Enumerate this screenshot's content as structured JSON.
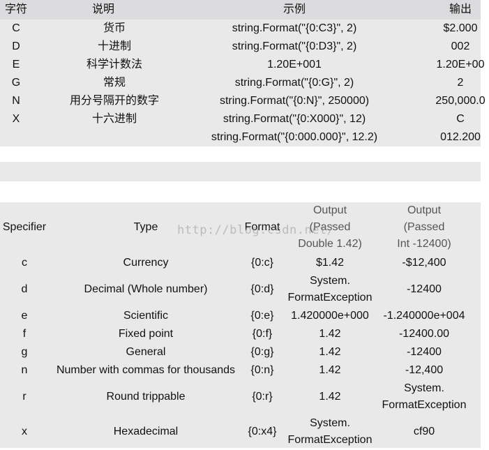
{
  "table1": {
    "headers": [
      "字符",
      "说明",
      "示例",
      "输出"
    ],
    "rows": [
      {
        "char": "C",
        "desc": "货币",
        "example": "string.Format(\"{0:C3}\", 2)",
        "output": "$2.000"
      },
      {
        "char": "D",
        "desc": "十进制",
        "example": "string.Format(\"{0:D3}\", 2)",
        "output": "002"
      },
      {
        "char": "E",
        "desc": "科学计数法",
        "example": "1.20E+001",
        "output": "1.20E+00"
      },
      {
        "char": "G",
        "desc": "常规",
        "example": "string.Format(\"{0:G}\", 2)",
        "output": "2"
      },
      {
        "char": "N",
        "desc": "用分号隔开的数字",
        "example": "string.Format(\"{0:N}\", 250000)",
        "output": "250,000.0"
      },
      {
        "char": "X",
        "desc": "十六进制",
        "example": "string.Format(\"{0:X000}\", 12)",
        "output": "C"
      },
      {
        "char": "",
        "desc": "",
        "example": "string.Format(\"{0:000.000}\", 12.2)",
        "output": "012.200"
      }
    ]
  },
  "table2": {
    "headers": {
      "specifier": "Specifier",
      "type": "Type",
      "format": "Format",
      "out_double": [
        "Output",
        "(Passed",
        "Double 1.42)"
      ],
      "out_int": [
        "Output",
        "(Passed",
        "Int -12400)"
      ]
    },
    "rows": [
      {
        "spec": "c",
        "type": "Currency",
        "format": "{0:c}",
        "double": [
          "$1.42"
        ],
        "int": [
          "-$12,400"
        ]
      },
      {
        "spec": "d",
        "type": "Decimal (Whole number)",
        "format": "{0:d}",
        "double": [
          "System.",
          "FormatException"
        ],
        "int": [
          "-12400"
        ]
      },
      {
        "spec": "e",
        "type": "Scientific",
        "format": "{0:e}",
        "double": [
          "1.420000e+000"
        ],
        "int": [
          "-1.240000e+004"
        ]
      },
      {
        "spec": "f",
        "type": "Fixed point",
        "format": "{0:f}",
        "double": [
          "1.42"
        ],
        "int": [
          "-12400.00"
        ]
      },
      {
        "spec": "g",
        "type": "General",
        "format": "{0:g}",
        "double": [
          "1.42"
        ],
        "int": [
          "-12400"
        ]
      },
      {
        "spec": "n",
        "type": "Number with commas for thousands",
        "format": "{0:n}",
        "double": [
          "1.42"
        ],
        "int": [
          "-12,400"
        ]
      },
      {
        "spec": "r",
        "type": "Round trippable",
        "format": "{0:r}",
        "double": [
          "1.42"
        ],
        "int": [
          "System.",
          "FormatException"
        ]
      },
      {
        "spec": "x",
        "type": "Hexadecimal",
        "format": "{0:x4}",
        "double": [
          "System.",
          "FormatException"
        ],
        "int": [
          "cf90"
        ]
      }
    ]
  },
  "watermark": "http://blog.csdn.net/"
}
